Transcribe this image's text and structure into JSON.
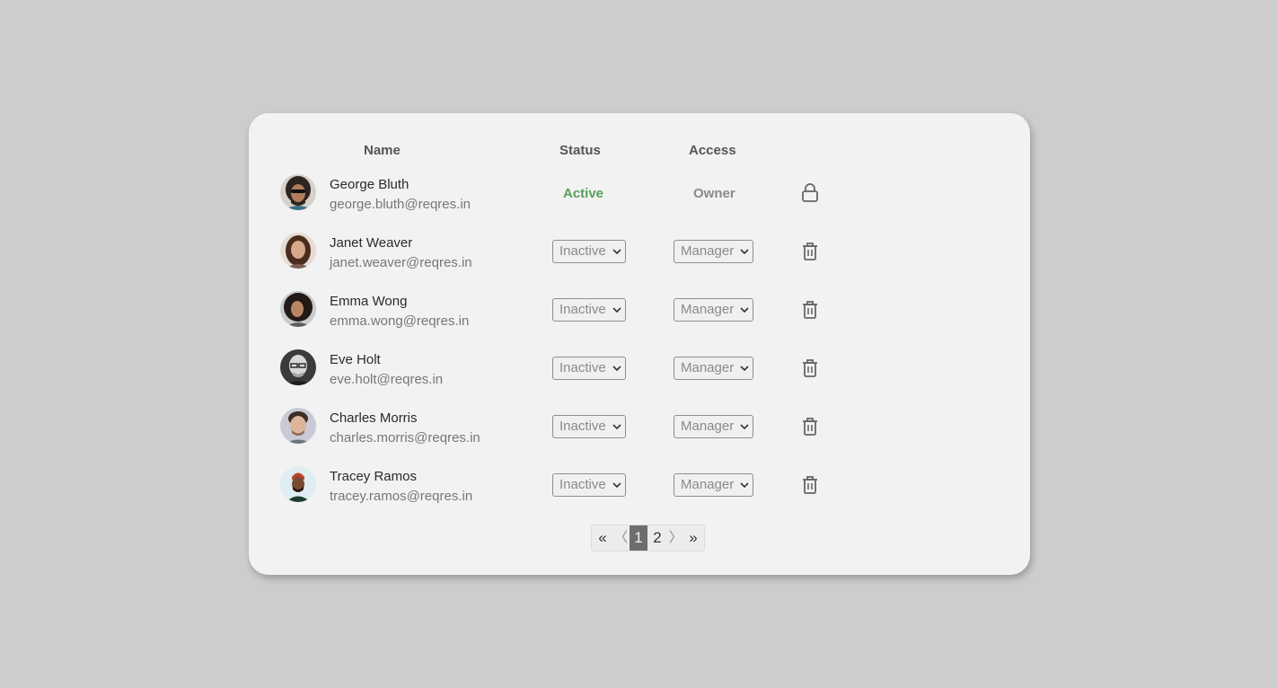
{
  "table": {
    "headers": {
      "name": "Name",
      "status": "Status",
      "access": "Access"
    }
  },
  "users": [
    {
      "name": "George Bluth",
      "email": "george.bluth@reqres.in",
      "status": "Active",
      "access": "Owner",
      "action_icon": "lock-icon"
    },
    {
      "name": "Janet Weaver",
      "email": "janet.weaver@reqres.in",
      "status": "Inactive",
      "access": "Manager",
      "action_icon": "trash-icon"
    },
    {
      "name": "Emma Wong",
      "email": "emma.wong@reqres.in",
      "status": "Inactive",
      "access": "Manager",
      "action_icon": "trash-icon"
    },
    {
      "name": "Eve Holt",
      "email": "eve.holt@reqres.in",
      "status": "Inactive",
      "access": "Manager",
      "action_icon": "trash-icon"
    },
    {
      "name": "Charles Morris",
      "email": "charles.morris@reqres.in",
      "status": "Inactive",
      "access": "Manager",
      "action_icon": "trash-icon"
    },
    {
      "name": "Tracey Ramos",
      "email": "tracey.ramos@reqres.in",
      "status": "Inactive",
      "access": "Manager",
      "action_icon": "trash-icon"
    }
  ],
  "pagination": {
    "first": "«",
    "prev": "〈",
    "pages": [
      "1",
      "2"
    ],
    "current": "1",
    "next": "〉",
    "last": "»"
  },
  "colors": {
    "background": "#cdcdcd",
    "card": "#f2f2f2",
    "active_status": "#57a05b",
    "current_page": "#6e6e6e"
  }
}
